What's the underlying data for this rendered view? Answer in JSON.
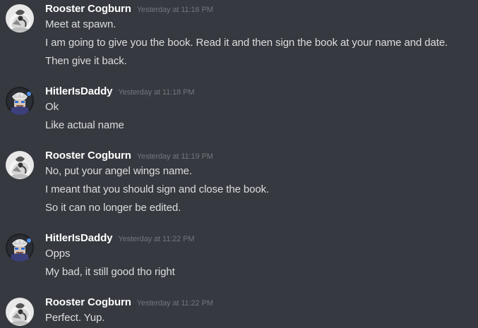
{
  "colors": {
    "background": "#36393f",
    "username": "#ffffff",
    "timestamp": "#72767d",
    "text": "#dcddde"
  },
  "messages": [
    {
      "author": "Rooster Cogburn",
      "avatar": "rooster-avatar-icon",
      "timestamp": "Yesterday at 11:16 PM",
      "lines": [
        "Meet at spawn.",
        "I am going to give you the book. Read it and then sign the book at your name and date.",
        "Then give it back."
      ]
    },
    {
      "author": "HitlerIsDaddy",
      "avatar": "hitlerisdaddy-avatar-icon",
      "timestamp": "Yesterday at 11:18 PM",
      "lines": [
        "Ok",
        "Like actual name"
      ]
    },
    {
      "author": "Rooster Cogburn",
      "avatar": "rooster-avatar-icon",
      "timestamp": "Yesterday at 11:19 PM",
      "lines": [
        "No, put your angel wings name.",
        "I meant that you should sign and close the book.",
        "So it can no longer be edited."
      ]
    },
    {
      "author": "HitlerIsDaddy",
      "avatar": "hitlerisdaddy-avatar-icon",
      "timestamp": "Yesterday at 11:22 PM",
      "lines": [
        "Opps",
        "My bad, it still good tho right"
      ]
    },
    {
      "author": "Rooster Cogburn",
      "avatar": "rooster-avatar-icon",
      "timestamp": "Yesterday at 11:22 PM",
      "lines": [
        "Perfect. Yup."
      ]
    }
  ]
}
